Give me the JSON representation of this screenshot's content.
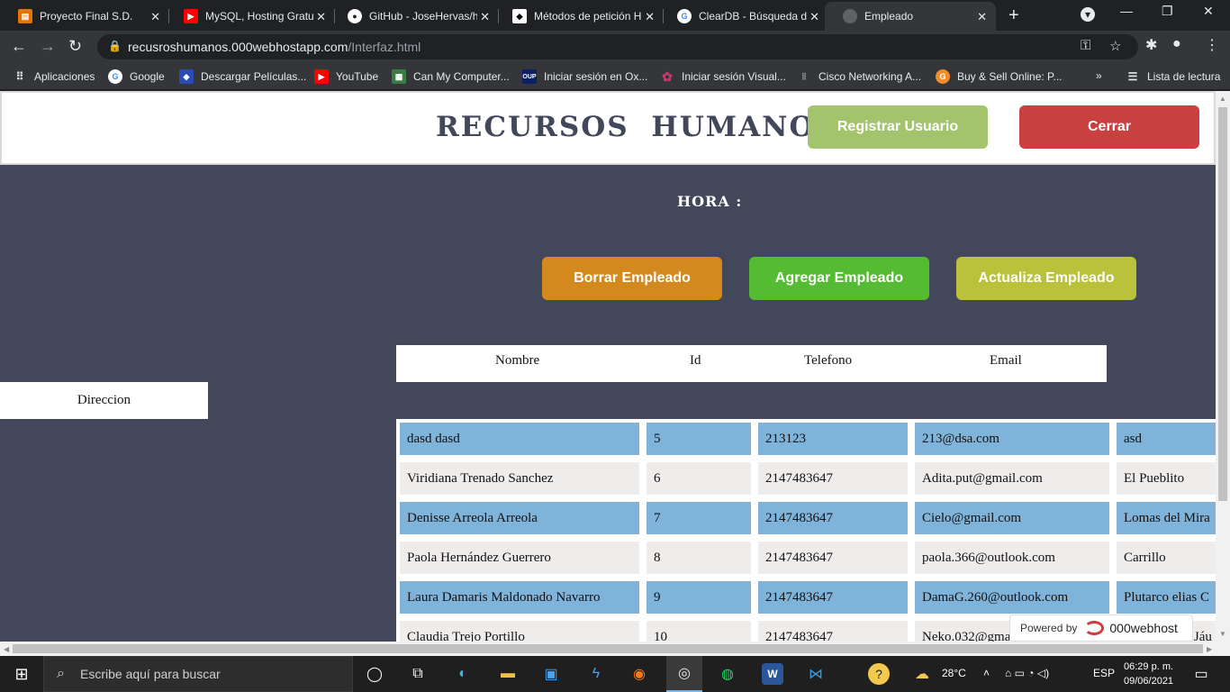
{
  "browser": {
    "tabs": [
      {
        "title": "Proyecto Final S.D.",
        "color": "#e37400"
      },
      {
        "title": "MySQL, Hosting Gratu",
        "color": "#ff0000"
      },
      {
        "title": "GitHub - JoseHervas/h",
        "color": "#ffffff"
      },
      {
        "title": "Métodos de petición H",
        "color": "#000000"
      },
      {
        "title": "ClearDB - Búsqueda de",
        "color": "#4285f4"
      },
      {
        "title": "Empleado",
        "color": "#5f6368"
      }
    ],
    "url_domain": "recusroshumanos.000webhostapp.com",
    "url_path": "/Interfaz.html",
    "bookmarks": [
      "Aplicaciones",
      "Google",
      "Descargar Películas...",
      "YouTube",
      "Can My Computer...",
      "Iniciar sesión en Ox...",
      "Iniciar sesión Visual...",
      "Cisco Networking A...",
      "Buy & Sell Online: P..."
    ],
    "reading_list": "Lista de lectura",
    "oup_badge": "OUP",
    "overflow": "»"
  },
  "page": {
    "title": "RECURSOS HUMANOS",
    "register_label": "Registrar Usuario",
    "close_label": "Cerrar",
    "hora_label": "HORA :",
    "delete_label": "Borrar Empleado",
    "add_label": "Agregar Empleado",
    "update_label": "Actualiza Empleado",
    "colors": {
      "background": "#43475a",
      "register": "#a3c46c",
      "close": "#c94040",
      "delete": "#d4891e",
      "add": "#55bb33",
      "update": "#b9c23a",
      "row_blue": "#80b3d9",
      "row_gray": "#efedec"
    }
  },
  "table": {
    "headers": [
      "Nombre",
      "Id",
      "Telefono",
      "Email"
    ],
    "direccion_header": "Direccion",
    "rows": [
      [
        "dasd dasd",
        "5",
        "213123",
        "213@dsa.com",
        "asd"
      ],
      [
        "Viridiana Trenado Sanchez",
        "6",
        "2147483647",
        "Adita.put@gmail.com",
        "El Pueblito"
      ],
      [
        "Denisse Arreola Arreola",
        "7",
        "2147483647",
        "Cielo@gmail.com",
        "Lomas del Mira"
      ],
      [
        "Paola Hernández Guerrero",
        "8",
        "2147483647",
        "paola.366@outlook.com",
        "Carrillo"
      ],
      [
        "Laura Damaris Maldonado Navarro",
        "9",
        "2147483647",
        "DamaG.260@outlook.com",
        "Plutarco elias C"
      ],
      [
        "Claudia Trejo Portillo",
        "10",
        "2147483647",
        "Neko.032@gmail.com",
        "San Rosa de Jáu"
      ]
    ]
  },
  "powered": {
    "label": "Powered by",
    "brand": "000webhost"
  },
  "taskbar": {
    "search_placeholder": "Escribe aquí para buscar",
    "temperature": "28°C",
    "language": "ESP",
    "time": "06:29 p. m.",
    "date": "09/06/2021"
  }
}
